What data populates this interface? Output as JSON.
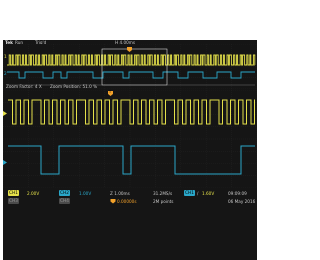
{
  "status_bar": {
    "logo": "Tek",
    "run_state": "Run",
    "trigger_state": "Trig'd",
    "horizontal_position": "H 4.00ms"
  },
  "overview": {
    "ch1_marker": "1",
    "ch2_marker": "2"
  },
  "zoom_info": {
    "zoom_factor": "Zoom Factor: 4 X",
    "zoom_position": "Zoom Position: 51.0 %"
  },
  "trigger_marker": "T",
  "zoom_window": {
    "ch1_marker": "1",
    "ch2_marker": "2"
  },
  "readout": {
    "ch1_label": "CH1",
    "ch1_scale": "2.00V",
    "ch2_label": "CH2",
    "ch2_scale": "1.00V",
    "time_scale": "Z 1.00ms",
    "sample_rate": "31.2MS/s",
    "trigger_source": "CH1",
    "trigger_slope": "/",
    "trigger_level": "1.60V",
    "time": "09:09:09",
    "date": "06 May 2016",
    "trigger_delay": "0.00000s",
    "record_length": "2M points",
    "ch3_label": "CH3",
    "ch4_label": "CH4"
  },
  "colors": {
    "background": "#151515",
    "ch1": "#e4e04a",
    "ch2": "#2aa7c9",
    "trigger": "#f2a12a",
    "text": "#c8c8c8",
    "grid": "#3b3b3b"
  }
}
